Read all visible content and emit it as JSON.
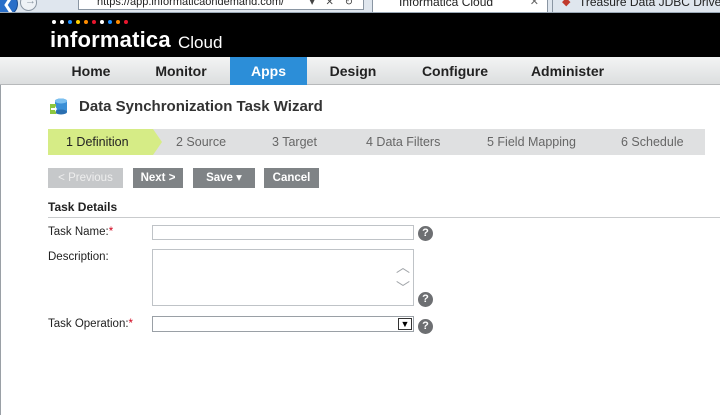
{
  "browser": {
    "back_glyph": "❮",
    "forward_glyph": "→",
    "address": "https://app.informaticaondemand.com/",
    "address_controls": "▾ ✕ ↻",
    "active_tab_title": "Informatica Cloud",
    "active_tab_close": "✕",
    "other_tab_title": "Treasure Data JDBC Driver",
    "other_tab_icon": "treasure-data-icon"
  },
  "header": {
    "logo_text": "informatica",
    "logo_sub": "Cloud",
    "logo_dot_colors": [
      "#ffffff",
      "#ffffff",
      "#1e90ff",
      "#ffd000",
      "#ff8c00",
      "#e8162e",
      "#ffffff",
      "#1e90ff",
      "#ff8c00",
      "#e8162e"
    ]
  },
  "nav": {
    "items": [
      {
        "label": "Home",
        "active": false
      },
      {
        "label": "Monitor",
        "active": false
      },
      {
        "label": "Apps",
        "active": true
      },
      {
        "label": "Design",
        "active": false
      },
      {
        "label": "Configure",
        "active": false
      },
      {
        "label": "Administer",
        "active": false
      }
    ],
    "active_color": "#2c8ed8"
  },
  "page": {
    "title": "Data Synchronization Task Wizard",
    "title_icon": "database-sync-icon"
  },
  "steps": [
    {
      "label": "1  Definition",
      "active": true
    },
    {
      "label": "2  Source",
      "active": false
    },
    {
      "label": "3  Target",
      "active": false
    },
    {
      "label": "4  Data Filters",
      "active": false
    },
    {
      "label": "5  Field Mapping",
      "active": false
    },
    {
      "label": "6  Schedule",
      "active": false
    }
  ],
  "toolbar": {
    "previous_label": "< Previous",
    "next_label": "Next >",
    "save_label": "Save ▾",
    "cancel_label": "Cancel"
  },
  "task_details": {
    "section_title": "Task Details",
    "task_name_label": "Task Name:",
    "task_name_value": "",
    "description_label": "Description:",
    "description_value": "",
    "task_operation_label": "Task Operation:",
    "task_operation_value": "",
    "required_marker": "*",
    "help_glyph": "?"
  }
}
